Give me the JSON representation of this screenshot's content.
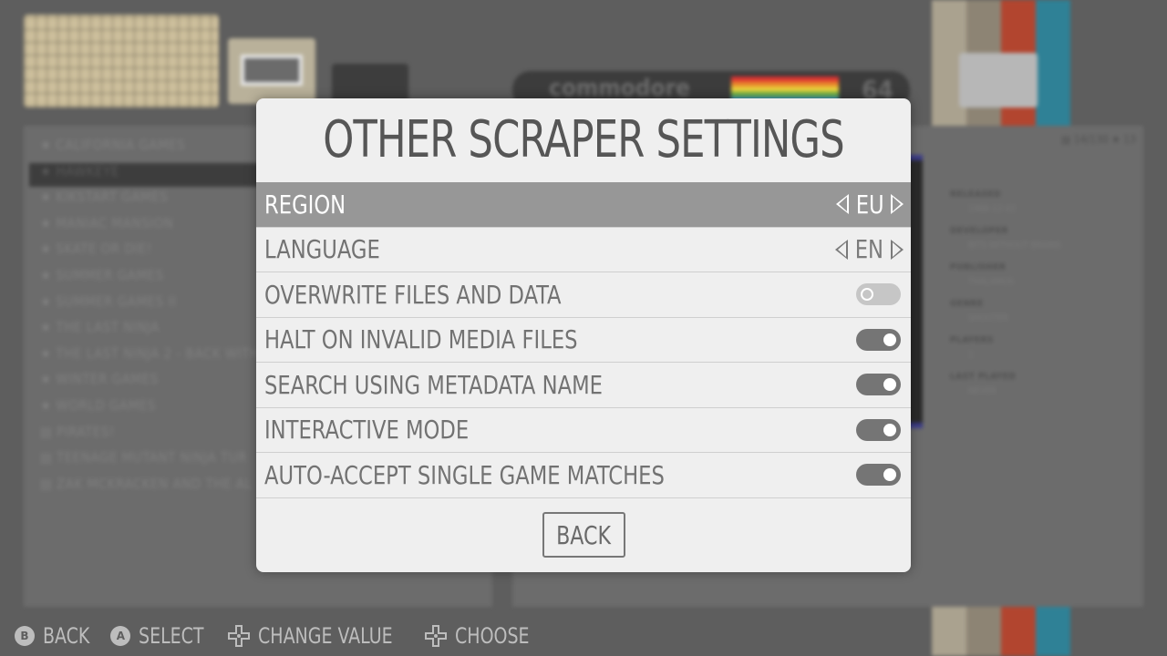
{
  "modal": {
    "title": "OTHER SCRAPER SETTINGS",
    "settings": [
      {
        "label": "REGION",
        "type": "selector",
        "value": "EU",
        "selected": true
      },
      {
        "label": "LANGUAGE",
        "type": "selector",
        "value": "EN",
        "selected": false
      },
      {
        "label": "OVERWRITE FILES AND DATA",
        "type": "toggle",
        "value": false
      },
      {
        "label": "HALT ON INVALID MEDIA FILES",
        "type": "toggle",
        "value": true
      },
      {
        "label": "SEARCH USING METADATA NAME",
        "type": "toggle",
        "value": true
      },
      {
        "label": "INTERACTIVE MODE",
        "type": "toggle",
        "value": true
      },
      {
        "label": "AUTO-ACCEPT SINGLE GAME MATCHES",
        "type": "toggle",
        "value": true
      }
    ],
    "back_label": "BACK"
  },
  "helpbar": [
    {
      "button": "B",
      "label": "BACK",
      "icon": "b-button-icon"
    },
    {
      "button": "A",
      "label": "SELECT",
      "icon": "a-button-icon"
    },
    {
      "button": "",
      "label": "CHANGE VALUE",
      "icon": "dpad-left-right-icon"
    },
    {
      "button": "",
      "label": "CHOOSE",
      "icon": "dpad-up-down-icon"
    }
  ],
  "background": {
    "system_brand": "commodore",
    "system_number": "64",
    "gamelist": [
      "CALIFORNIA GAMES",
      "HAWKEYE",
      "KIKSTART GAMES",
      "MANIAC MANSION",
      "SKATE OR DIE!",
      "SUMMER GAMES",
      "SUMMER GAMES II",
      "THE LAST NINJA",
      "THE LAST NINJA 2 - BACK WITH",
      "WINTER GAMES",
      "WORLD GAMES",
      "PIRATES!",
      "TEENAGE MUTANT NINJA TUR",
      "ZAK MCKRACKEN AND THE AL"
    ],
    "selected_game_index": 1,
    "counts": "▤ 14/130  ★ 13",
    "metadata": [
      {
        "label": "RELEASED",
        "value": "1988-12-02"
      },
      {
        "label": "DEVELOPER",
        "value": "BITS WITHOUT BRAINS"
      },
      {
        "label": "PUBLISHER",
        "value": "THALAMUS"
      },
      {
        "label": "GENRE",
        "value": "SHOOTER"
      },
      {
        "label": "PLAYERS",
        "value": "1"
      },
      {
        "label": "LAST PLAYED",
        "value": "NEVER"
      }
    ]
  },
  "colors": {
    "modal_bg": "#efefef",
    "selected_row": "#979797",
    "toggle_on": "#757575",
    "toggle_off": "#c6c6c6",
    "stripes": [
      "#c2b59b",
      "#9a8e7a",
      "#c9412a",
      "#2c8aa0"
    ]
  }
}
